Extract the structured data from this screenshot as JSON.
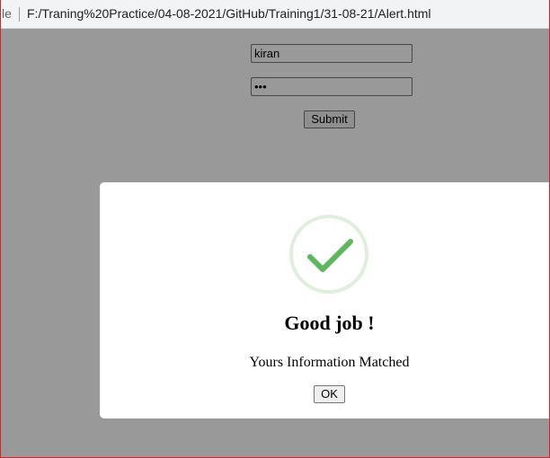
{
  "browser": {
    "address_prefix": "le",
    "url": "F:/Traning%20Practice/04-08-2021/GitHub/Training1/31-08-21/Alert.html"
  },
  "form": {
    "username_value": "kiran",
    "password_value": "•••",
    "submit_label": "Submit"
  },
  "alert": {
    "icon": "success-check-icon",
    "title": "Good job !",
    "message": "Yours Information Matched",
    "ok_label": "OK",
    "accent_color": "#5cb85c"
  }
}
